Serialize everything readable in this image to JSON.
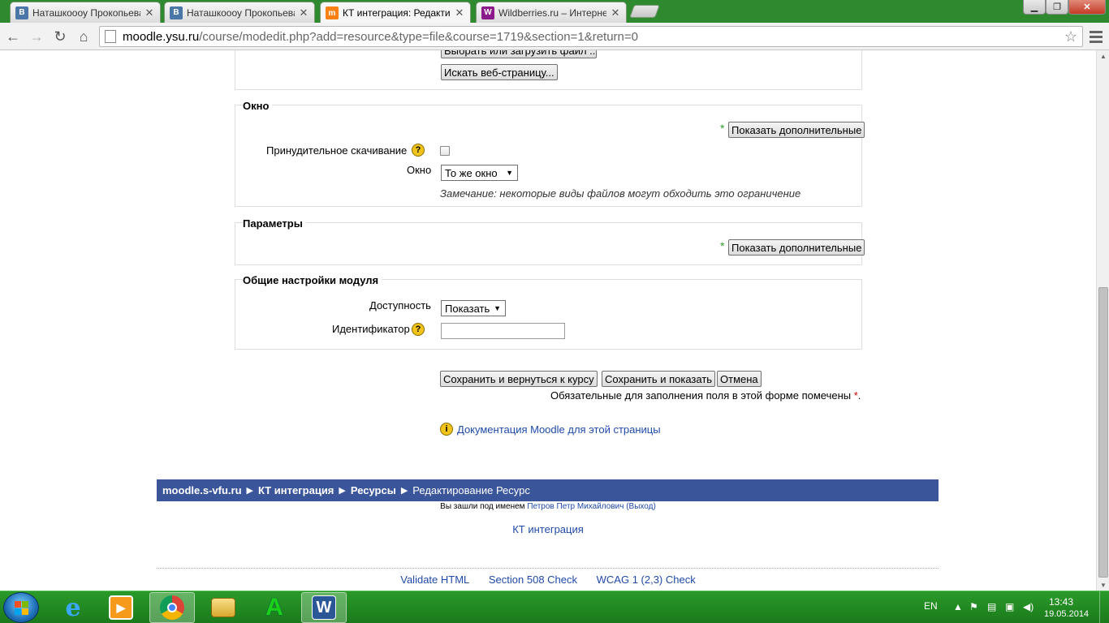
{
  "browser": {
    "tabs": [
      {
        "favicon": "B",
        "favicon_color": "#4a76a8",
        "title": "Наташкоооу Прокопьева",
        "active": false
      },
      {
        "favicon": "B",
        "favicon_color": "#4a76a8",
        "title": "Наташкоооу Прокопьева",
        "active": false
      },
      {
        "favicon": "m",
        "favicon_color": "#f98012",
        "title": "КТ интеграция: Редактир",
        "active": true
      },
      {
        "favicon": "W",
        "favicon_color": "#8b1a8b",
        "title": "Wildberries.ru – Интернет",
        "active": false
      }
    ],
    "url_host": "moodle.ysu.ru",
    "url_path": "/course/modedit.php?add=resource&type=file&course=1719&section=1&return=0",
    "icons": {
      "back": "back-arrow-icon",
      "forward": "forward-arrow-icon",
      "reload": "reload-icon",
      "home": "home-icon",
      "star": "bookmark-star-icon",
      "menu": "hamburger-menu-icon"
    }
  },
  "page": {
    "file_section": {
      "choose_file_button": "Выбрать или загрузить файл ...",
      "search_web_button": "Искать веб-страницу..."
    },
    "window_section": {
      "legend": "Окно",
      "show_more_button": "Показать дополнительные",
      "force_download_label": "Принудительное скачивание",
      "force_download_checked": false,
      "window_label": "Окно",
      "window_value": "То же окно",
      "note": "Замечание: некоторые виды файлов могут обходить это ограничение"
    },
    "params_section": {
      "legend": "Параметры",
      "show_more_button": "Показать дополнительные"
    },
    "module_section": {
      "legend": "Общие настройки модуля",
      "availability_label": "Доступность",
      "availability_value": "Показать",
      "id_label": "Идентификатор",
      "id_value": ""
    },
    "actions": {
      "save_return": "Сохранить и вернуться к курсу",
      "save_show": "Сохранить и показать",
      "cancel": "Отмена",
      "required_note": "Обязательные для заполнения поля в этой форме помечены",
      "required_star": "*",
      "period": "."
    },
    "doc_link": "Документация Moodle для этой страницы",
    "breadcrumb": [
      {
        "label": "moodle.s-vfu.ru"
      },
      {
        "label": "КТ интеграция"
      },
      {
        "label": "Ресурсы"
      },
      {
        "label": "Редактирование Ресурс"
      }
    ],
    "logged_in": {
      "prefix": "Вы зашли под именем",
      "user": "Петров Петр Михайлович",
      "logout": "(Выход)"
    },
    "course_link": "КТ интеграция",
    "validators": [
      "Validate HTML",
      "Section 508 Check",
      "WCAG 1 (2,3) Check"
    ]
  },
  "taskbar": {
    "apps": [
      "internet-explorer",
      "media-player",
      "chrome",
      "file-explorer",
      "green-a-app",
      "word"
    ],
    "lang": "EN",
    "time": "13:43",
    "date": "19.05.2014"
  }
}
